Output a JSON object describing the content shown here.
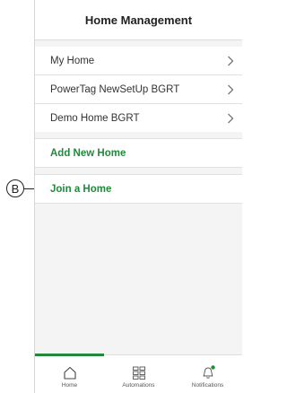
{
  "header": {
    "title": "Home Management"
  },
  "homes": [
    {
      "label": "My Home"
    },
    {
      "label": "PowerTag NewSetUp BGRT"
    },
    {
      "label": "Demo Home BGRT"
    }
  ],
  "actions": {
    "add_home": "Add New Home",
    "join_home": "Join a Home"
  },
  "callout": {
    "label": "B"
  },
  "tabbar": {
    "tabs": [
      {
        "label": "Home",
        "icon": "home-icon",
        "active": true
      },
      {
        "label": "Automations",
        "icon": "grid-icon",
        "active": false
      },
      {
        "label": "Notifications",
        "icon": "bell-icon",
        "active": false
      }
    ]
  },
  "colors": {
    "accent": "#1f8a3a",
    "background": "#f4f4f5"
  }
}
